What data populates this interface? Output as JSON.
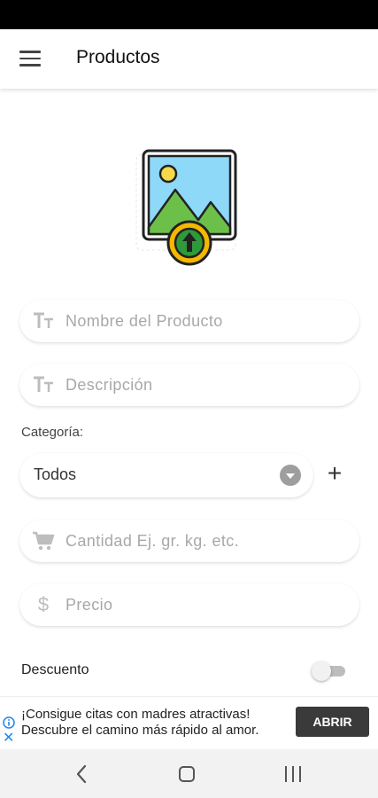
{
  "app_bar": {
    "title": "Productos",
    "menu_icon": "hamburger-menu-icon"
  },
  "image_upload": {
    "icon": "image-upload-icon",
    "colors": {
      "sky": "#8ed8f8",
      "mountains": "#6cc04a",
      "upload_badge": "#f5b800",
      "upload_inner": "#2e9a3a"
    }
  },
  "form": {
    "name_field": {
      "placeholder": "Nombre del Producto",
      "value": "",
      "icon": "text-size-icon"
    },
    "description_field": {
      "placeholder": "Descripción",
      "value": "",
      "icon": "text-size-icon"
    },
    "category": {
      "label": "Categoría:",
      "selected": "Todos",
      "dropdown_icon": "dropdown-caret-icon",
      "add_label": "+"
    },
    "quantity_field": {
      "placeholder": "Cantidad Ej. gr. kg. etc.",
      "value": "",
      "icon": "cart-icon"
    },
    "price_field": {
      "placeholder": "Precio",
      "value": "",
      "icon": "dollar-icon",
      "symbol": "$"
    },
    "discount": {
      "label": "Descuento",
      "enabled": false
    }
  },
  "ad": {
    "line1": "¡Consigue citas con madres atractivas!",
    "line2": "Descubre el camino más rápido al amor.",
    "button": "ABRIR",
    "info_icon": "info-icon",
    "close_icon": "close-icon",
    "close_glyph": "✕"
  },
  "nav": {
    "back_icon": "back-icon",
    "home_icon": "home-icon",
    "recents_icon": "recents-icon"
  }
}
